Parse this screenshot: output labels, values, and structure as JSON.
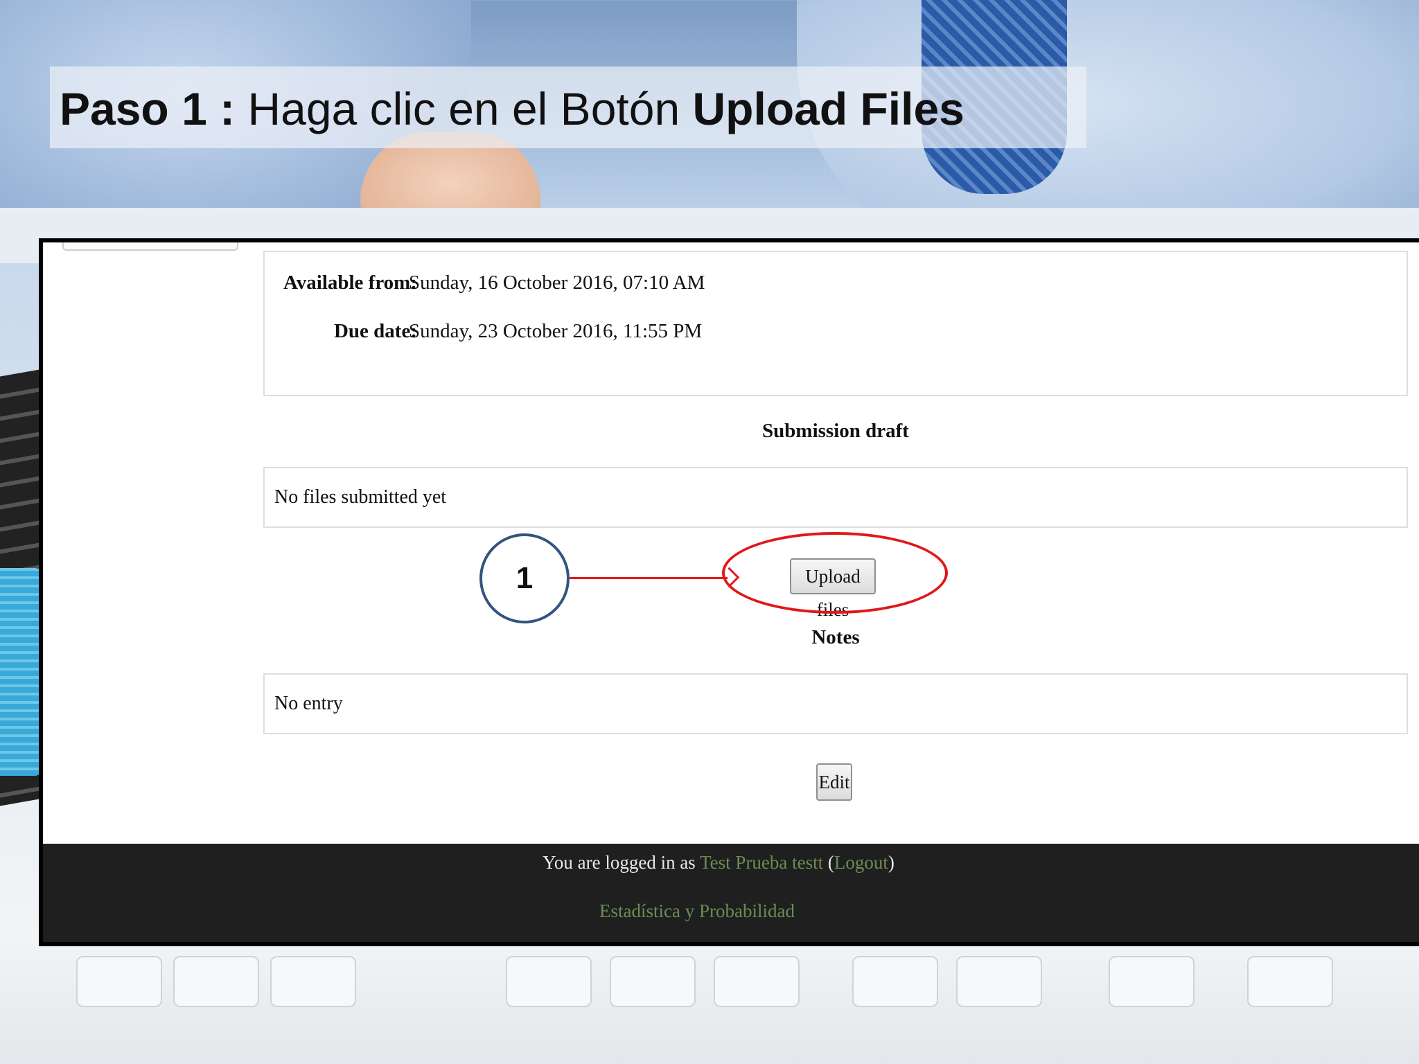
{
  "slide": {
    "title_strong": "Paso 1 :",
    "title_text": " Haga clic en el Botón ",
    "title_strong_end": "Upload Files"
  },
  "dates": {
    "available_label": "Available from:",
    "available_value": "Sunday, 16 October 2016, 07:10 AM",
    "due_label": "Due date:",
    "due_value": "Sunday, 23 October 2016, 11:55 PM"
  },
  "submission": {
    "heading": "Submission draft",
    "files_status": "No files submitted yet",
    "upload_button": "Upload files"
  },
  "notes": {
    "heading": "Notes",
    "entry": "No entry",
    "edit_button": "Edit"
  },
  "annotation": {
    "step_number": "1",
    "colors": {
      "circle": "#32557f",
      "arrow": "#e31b1b",
      "ellipse": "#e01818"
    }
  },
  "footer": {
    "logged_in_prefix": "You are logged in as ",
    "user_name": "Test Prueba testt",
    "logout_open": " (",
    "logout_label": "Logout",
    "logout_close": ")",
    "course_name": "Estadística y Probabilidad",
    "link_color": "#6b8c54"
  }
}
